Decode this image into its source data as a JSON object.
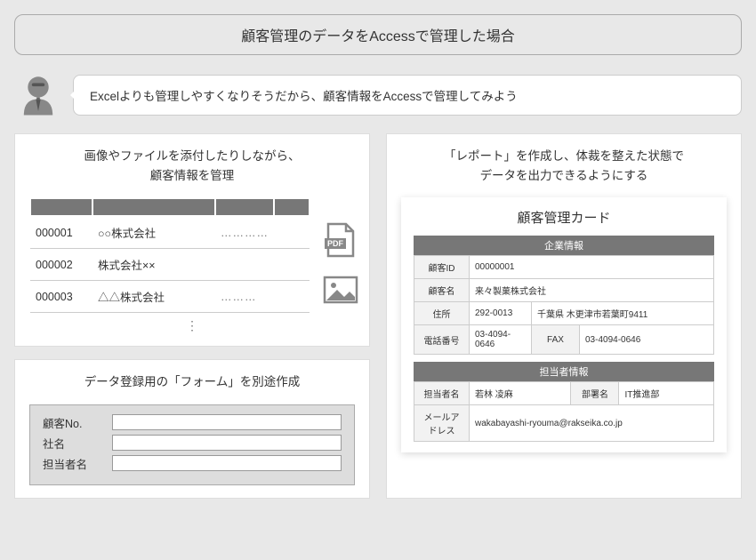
{
  "title": "顧客管理のデータをAccessで管理した場合",
  "speech": "Excelよりも管理しやすくなりそうだから、顧客情報をAccessで管理してみよう",
  "panel1": {
    "title": "画像やファイルを添付したりしながら、\n顧客情報を管理",
    "rows": [
      {
        "id": "000001",
        "name": "○○株式会社",
        "dots": "…………"
      },
      {
        "id": "000002",
        "name": "株式会社××",
        "dots": ""
      },
      {
        "id": "000003",
        "name": "△△株式会社",
        "dots": "………"
      }
    ],
    "pdf_label": "PDF",
    "vdots": "⋮"
  },
  "panel2": {
    "title": "データ登録用の「フォーム」を別途作成",
    "fields": [
      "顧客No.",
      "社名",
      "担当者名"
    ]
  },
  "panel3": {
    "title": "「レポート」を作成し、体裁を整えた状態で\nデータを出力できるようにする",
    "report": {
      "card_title": "顧客管理カード",
      "section1": "企業情報",
      "section2": "担当者情報",
      "labels": {
        "id": "顧客ID",
        "name": "顧客名",
        "addr": "住所",
        "tel": "電話番号",
        "fax": "FAX",
        "person": "担当者名",
        "dept": "部署名",
        "email": "メールアドレス"
      },
      "values": {
        "id": "00000001",
        "name": "来々製菓株式会社",
        "zip": "292-0013",
        "addr": "千葉県 木更津市若葉町9411",
        "tel": "03-4094-0646",
        "fax": "03-4094-0646",
        "person": "若林 凌麻",
        "dept": "IT推進部",
        "email": "wakabayashi-ryouma@rakseika.co.jp"
      }
    }
  }
}
